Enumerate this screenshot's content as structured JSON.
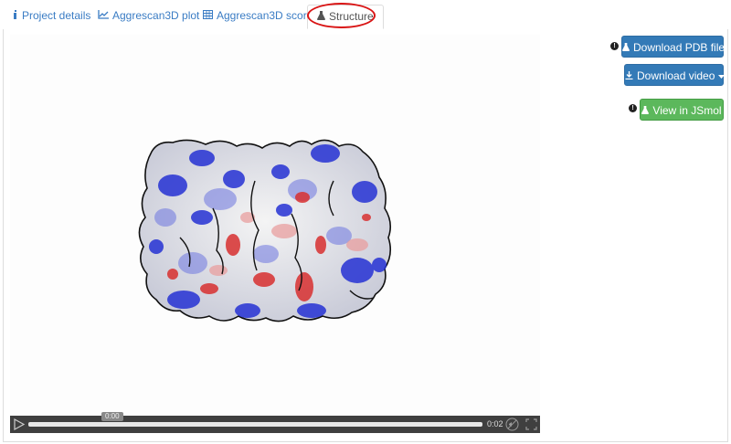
{
  "tabs": [
    {
      "label": "Project details",
      "icon": "info-icon"
    },
    {
      "label": "Aggrescan3D plot",
      "icon": "line-chart-icon"
    },
    {
      "label": "Aggrescan3D score",
      "icon": "table-icon"
    },
    {
      "label": "Structure",
      "icon": "flask-icon",
      "active": true
    }
  ],
  "video": {
    "current_time": "0:00",
    "end_time": "0:02"
  },
  "actions": {
    "download_pdb": "Download PDB file",
    "download_video": "Download video",
    "view_jsmol": "View in JSmol"
  },
  "colors": {
    "link": "#3a7cc4",
    "primary": "#337ab7",
    "success": "#5cb85c",
    "highlight": "#d91414",
    "hydrophobic": "#d83030",
    "soluble": "#1f2fd0"
  }
}
